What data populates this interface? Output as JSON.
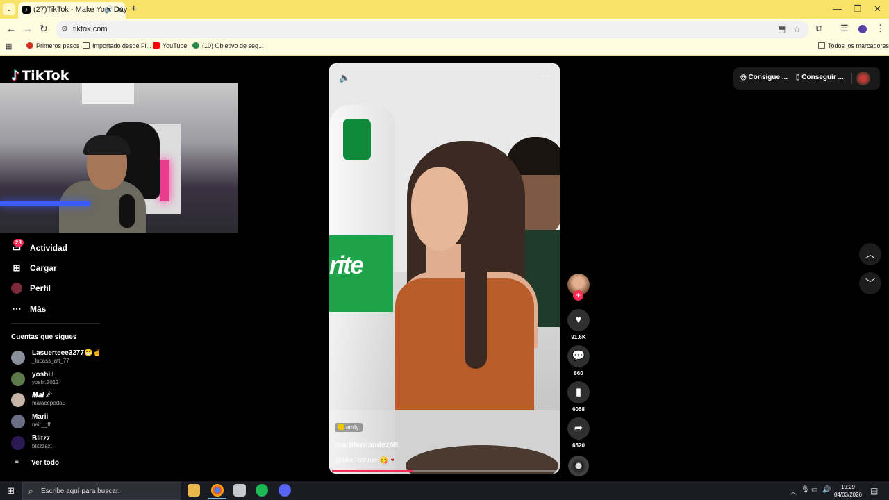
{
  "browser": {
    "tab": {
      "title": "(27)TikTok - Make Your Day"
    },
    "url": "tiktok.com",
    "bookmarks": [
      {
        "label": "Primeros pasos",
        "icon": "chrome-icon"
      },
      {
        "label": "Importado desde Fi...",
        "icon": "folder-icon"
      },
      {
        "label": "YouTube",
        "icon": "youtube-icon"
      },
      {
        "label": "(10) Objetivo de seg...",
        "icon": "site-icon"
      }
    ],
    "all_bookmarks": "Todos los marcadores"
  },
  "tiktok": {
    "logo": "TikTok",
    "nav": [
      {
        "label": "Actividad",
        "icon": "inbox-icon",
        "badge": "23"
      },
      {
        "label": "Cargar",
        "icon": "upload-icon"
      },
      {
        "label": "Perfil",
        "icon": "profile-icon"
      },
      {
        "label": "Más",
        "icon": "more-icon"
      }
    ],
    "following_title": "Cuentas que sigues",
    "accounts": [
      {
        "name": "Lasuerteee3277😁✌",
        "handle": "_lucass_att_77",
        "color": "#8b8f9a"
      },
      {
        "name": "yoshi.l",
        "handle": "yoshi.2012",
        "color": "#5f7a4a"
      },
      {
        "name": "𝑴𝒂𝒊 ☄",
        "handle": "malacepeda5",
        "color": "#c6b6a8"
      },
      {
        "name": "Marii",
        "handle": "nair__ff",
        "color": "#6a6f86"
      },
      {
        "name": "Blitzz",
        "handle": "blitzzaxt",
        "color": "#2c1a54"
      }
    ],
    "see_all": "Ver todo",
    "topbar": {
      "coins": "Consigue ...",
      "app": "Conseguir ..."
    },
    "video": {
      "tag": "emily",
      "author": "martifernandez68",
      "caption": "@Mia Röhner 😋🍷",
      "progress": 0.36,
      "bottle_text": "rite"
    },
    "actions": {
      "likes": "91.6K",
      "comments": "860",
      "saves": "6058",
      "shares": "6520"
    }
  },
  "taskbar": {
    "search_placeholder": "Escribe aquí para buscar.",
    "time": "19:29",
    "date": "04/03/2026"
  }
}
